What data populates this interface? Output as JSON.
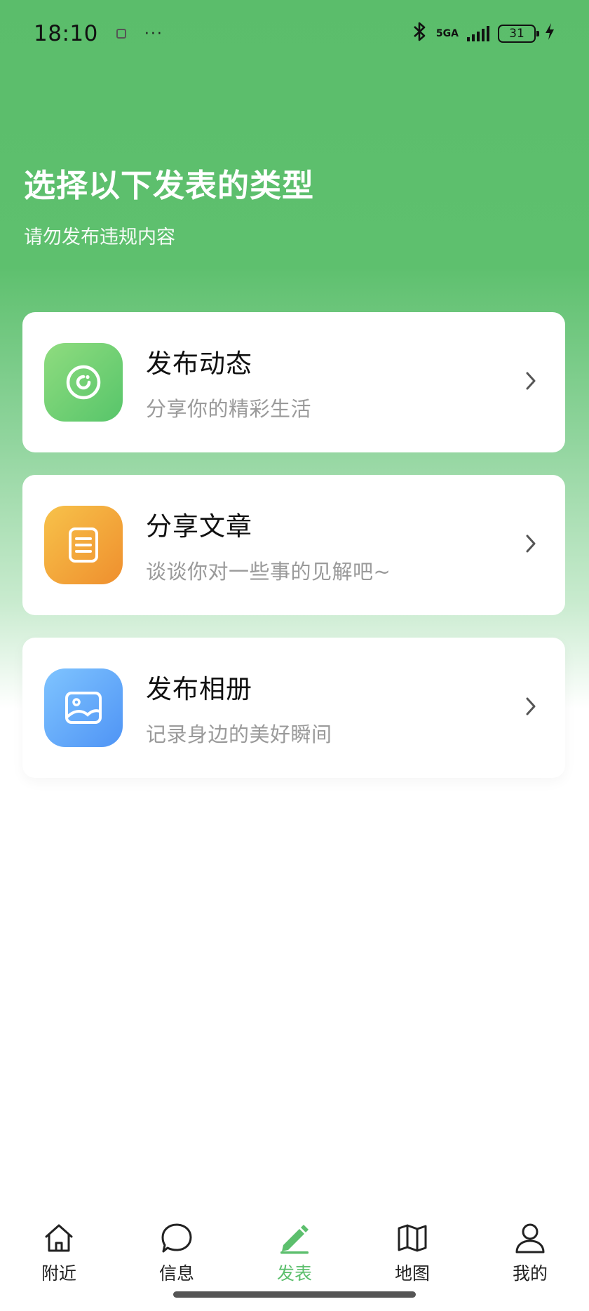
{
  "status_bar": {
    "time": "18:10",
    "dots": "···",
    "network": "5GA",
    "battery": "31",
    "icons": [
      "notification-icon",
      "bluetooth-icon",
      "signal-icon",
      "battery-icon",
      "charging-icon"
    ]
  },
  "header": {
    "title": "选择以下发表的类型",
    "subtitle": "请勿发布违规内容"
  },
  "options": [
    {
      "title": "发布动态",
      "desc": "分享你的精彩生活",
      "icon": "moment-icon",
      "color": "#5ec46c"
    },
    {
      "title": "分享文章",
      "desc": "谈谈你对一些事的见解吧~",
      "icon": "article-icon",
      "color": "#f0a03a"
    },
    {
      "title": "发布相册",
      "desc": "记录身边的美好瞬间",
      "icon": "album-icon",
      "color": "#5c9ff5"
    }
  ],
  "tabbar": {
    "active_color": "#5cbf6d",
    "items": [
      {
        "label": "附近",
        "icon": "home-icon"
      },
      {
        "label": "信息",
        "icon": "message-icon"
      },
      {
        "label": "发表",
        "icon": "edit-icon",
        "active": true
      },
      {
        "label": "地图",
        "icon": "map-icon"
      },
      {
        "label": "我的",
        "icon": "profile-icon"
      }
    ]
  }
}
